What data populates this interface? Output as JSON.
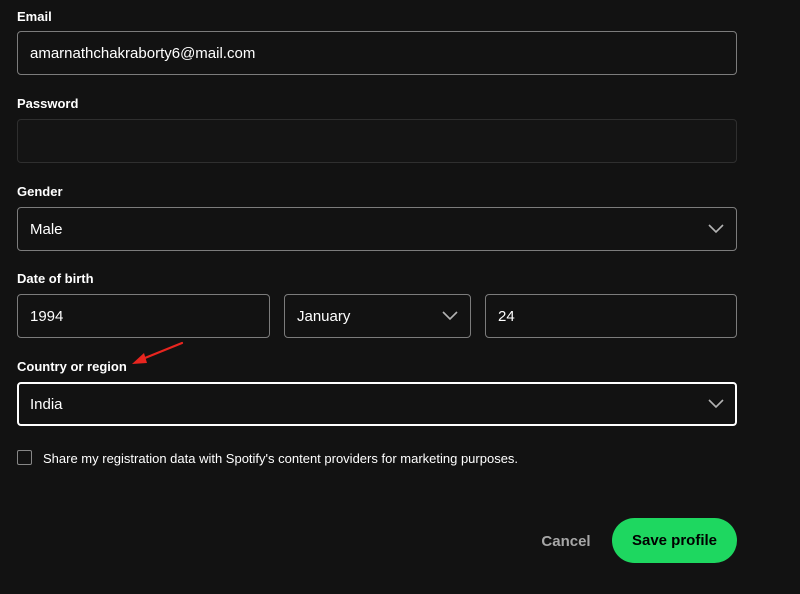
{
  "form": {
    "email": {
      "label": "Email",
      "value": "amarnathchakraborty6@mail.com"
    },
    "password": {
      "label": "Password",
      "value": ""
    },
    "gender": {
      "label": "Gender",
      "value": "Male"
    },
    "dob": {
      "label": "Date of birth",
      "year": "1994",
      "month": "January",
      "day": "24"
    },
    "country": {
      "label": "Country or region",
      "value": "India"
    },
    "marketing": {
      "label": "Share my registration data with Spotify's content providers for marketing purposes.",
      "checked": false
    }
  },
  "actions": {
    "cancel_label": "Cancel",
    "save_label": "Save profile"
  },
  "colors": {
    "background": "#121212",
    "accent": "#1ed760",
    "annotation_arrow": "#e8251f"
  },
  "icons": {
    "dropdown": "chevron-down-icon",
    "annotation": "red-arrow-annotation"
  }
}
